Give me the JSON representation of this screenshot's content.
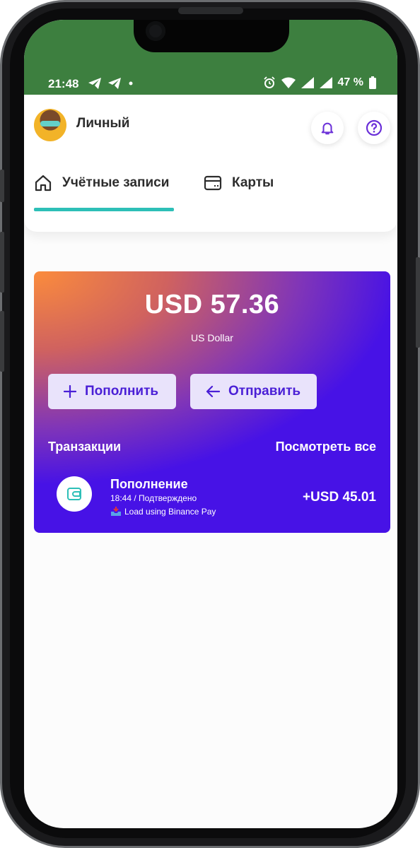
{
  "status_bar": {
    "time": "21:48",
    "battery_text": "47 %",
    "left_icons": [
      "telegram-icon",
      "telegram-icon",
      "dot-icon"
    ],
    "right_icons": [
      "alarm-icon",
      "wifi-icon",
      "signal-icon",
      "signal-icon",
      "battery-icon"
    ]
  },
  "header": {
    "profile_name": "Личный",
    "tabs": [
      {
        "label": "Учётные записи",
        "icon": "home-icon",
        "active": true
      },
      {
        "label": "Карты",
        "icon": "card-icon",
        "active": false
      }
    ]
  },
  "balance_card": {
    "balance": "USD 57.36",
    "currency_name": "US Dollar",
    "topup_label": "Пополнить",
    "send_label": "Отправить",
    "transactions_title": "Транзакции",
    "view_all_label": "Посмотреть все"
  },
  "transactions": [
    {
      "title": "Пополнение",
      "subtitle": "18:44 / Подтверждено",
      "note": "Load using Binance Pay",
      "amount": "+USD 45.01",
      "icon": "wallet-icon"
    }
  ],
  "colors": {
    "status_bar": "#3d7f3f",
    "accent_teal": "#2dbfb7",
    "card_purple": "#4712e6",
    "card_orange": "#fb8c3c",
    "button_bg": "#e9e3fb",
    "button_text": "#4a1fd6",
    "icon_purple": "#6a2fd8"
  }
}
